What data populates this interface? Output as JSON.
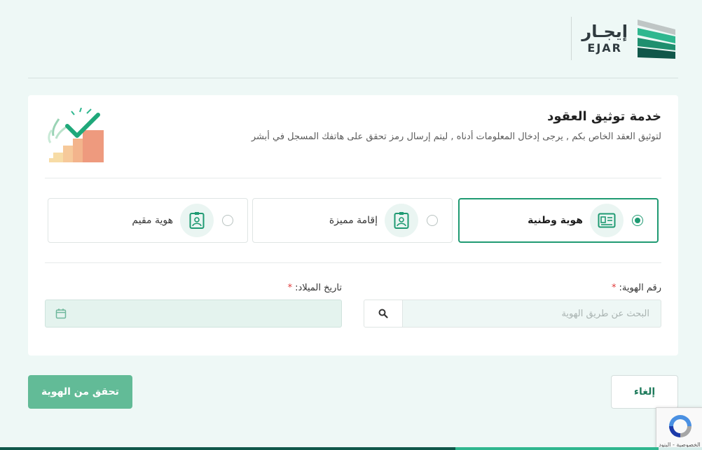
{
  "header": {
    "logo_arabic": "إيجـار",
    "logo_english": "EJAR"
  },
  "card": {
    "title": "خدمة توثيق العقود",
    "subtitle": "لتوثيق العقد الخاص بكم , يرجى إدخال المعلومات أدناه , ليتم إرسال رمز تحقق على هاتفك المسجل في أبشر"
  },
  "id_types": [
    {
      "label": "هوية وطنية",
      "selected": true,
      "icon": "id-card-icon"
    },
    {
      "label": "إقامة مميزة",
      "selected": false,
      "icon": "badge-icon"
    },
    {
      "label": "هوية مقيم",
      "selected": false,
      "icon": "badge-icon"
    }
  ],
  "form": {
    "id_label": "رقم الهوية:",
    "id_required": "*",
    "id_placeholder": "البحث عن طريق الهوية",
    "id_value": "",
    "dob_label": "تاريخ الميلاد:",
    "dob_required": "*",
    "dob_value": ""
  },
  "actions": {
    "verify_label": "تحقق من الهوية",
    "cancel_label": "إلغاء"
  },
  "recaptcha": {
    "links": "الخصوصية - البنود"
  },
  "colors": {
    "primary": "#1f9a72",
    "verify_button": "#62bb97",
    "required": "#e03b3b",
    "background": "#eef8f6"
  }
}
